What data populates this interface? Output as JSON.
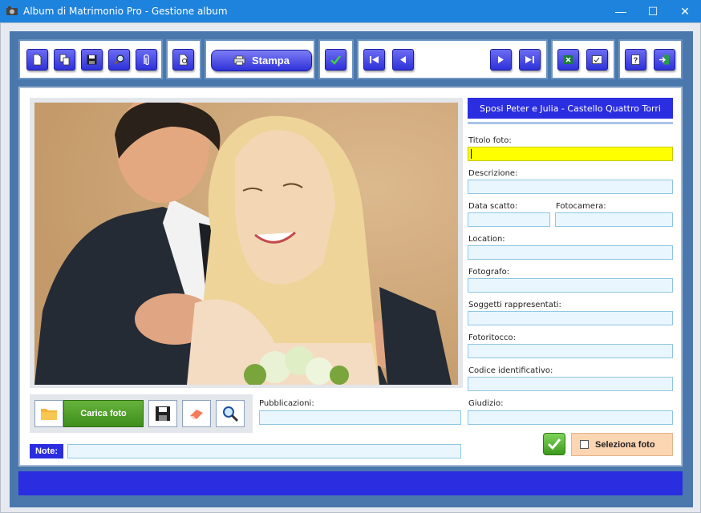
{
  "window": {
    "title": "Album di Matrimonio Pro - Gestione album",
    "minimize": "—",
    "maximize": "☐",
    "close": "✕"
  },
  "toolbar": {
    "print_label": "Stampa",
    "icons": [
      "new-icon",
      "copy-icon",
      "save-icon",
      "search-icon",
      "attach-icon",
      "preview-icon",
      "print-icon",
      "confirm-icon",
      "first-icon",
      "prev-icon",
      "next-icon",
      "last-icon",
      "excel-icon",
      "export-icon",
      "help-icon",
      "exit-icon"
    ]
  },
  "album": {
    "couple_banner": "Sposi Peter e Julia - Castello Quattro Torri"
  },
  "photo_tools": {
    "load_label": "Carica foto"
  },
  "fields": {
    "titolo": {
      "label": "Titolo foto:",
      "value": ""
    },
    "descrizione": {
      "label": "Descrizione:",
      "value": ""
    },
    "data_scatto": {
      "label": "Data scatto:",
      "value": ""
    },
    "fotocamera": {
      "label": "Fotocamera:",
      "value": ""
    },
    "location": {
      "label": "Location:",
      "value": ""
    },
    "fotografo": {
      "label": "Fotografo:",
      "value": ""
    },
    "soggetti": {
      "label": "Soggetti rappresentati:",
      "value": ""
    },
    "fotoritocco": {
      "label": "Fotoritocco:",
      "value": ""
    },
    "codice": {
      "label": "Codice identificativo:",
      "value": ""
    },
    "giudizio": {
      "label": "Giudizio:",
      "value": ""
    },
    "pubblicazioni": {
      "label": "Pubblicazioni:",
      "value": ""
    },
    "note": {
      "label": "Note:",
      "value": ""
    }
  },
  "selection": {
    "select_label": "Seleziona foto",
    "checked": false
  },
  "colors": {
    "accent": "#2b2de0",
    "titlebar": "#1e83dd",
    "frame": "#4a78ad",
    "highlight_field": "#ffff00",
    "select_bg": "#fcd5b3"
  }
}
